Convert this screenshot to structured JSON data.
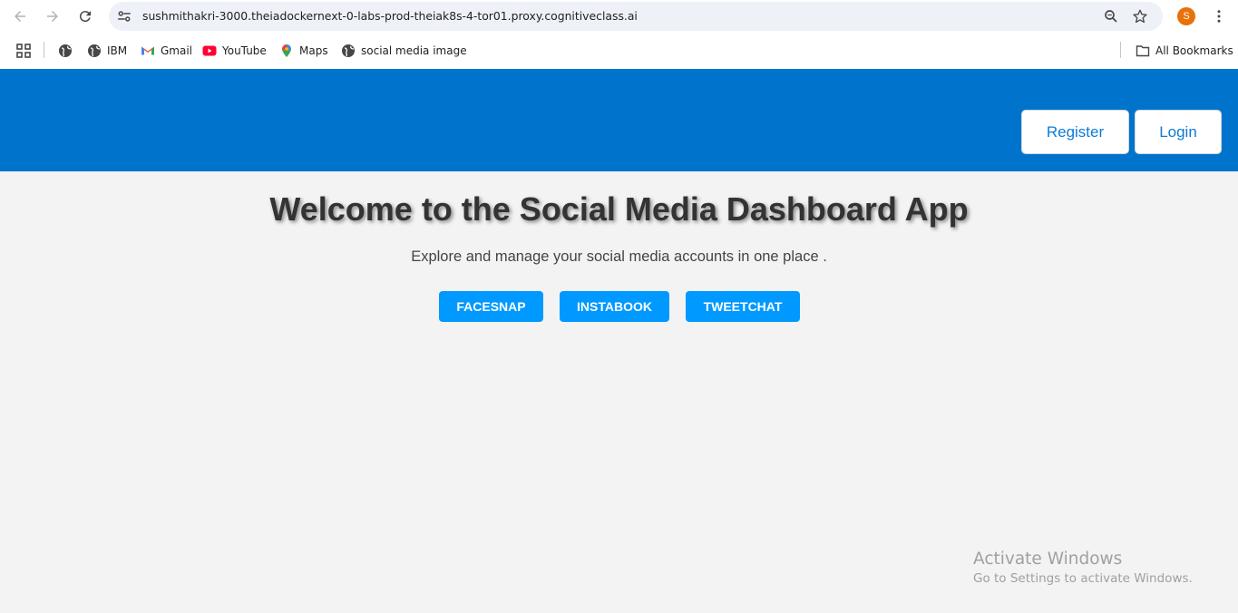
{
  "browser": {
    "url": "sushmithakri-3000.theiadockernext-0-labs-prod-theiak8s-4-tor01.proxy.cognitiveclass.ai",
    "profile_initial": "S",
    "bookmarks": [
      {
        "label": "",
        "icon": "globe-icon"
      },
      {
        "label": "IBM",
        "icon": "globe-icon"
      },
      {
        "label": "Gmail",
        "icon": "gmail-icon"
      },
      {
        "label": "YouTube",
        "icon": "youtube-icon"
      },
      {
        "label": "Maps",
        "icon": "maps-icon"
      },
      {
        "label": "social media image",
        "icon": "globe-icon"
      }
    ],
    "all_bookmarks_label": "All Bookmarks"
  },
  "header": {
    "register_label": "Register",
    "login_label": "Login",
    "accent_color": "#0074cc"
  },
  "main": {
    "title": "Welcome to the Social Media Dashboard App",
    "subtitle": "Explore and manage your social media accounts in one place .",
    "apps": [
      "FACESNAP",
      "INSTABOOK",
      "TWEETCHAT"
    ],
    "button_color": "#0099ff"
  },
  "watermark": {
    "line1": "Activate Windows",
    "line2": "Go to Settings to activate Windows."
  }
}
